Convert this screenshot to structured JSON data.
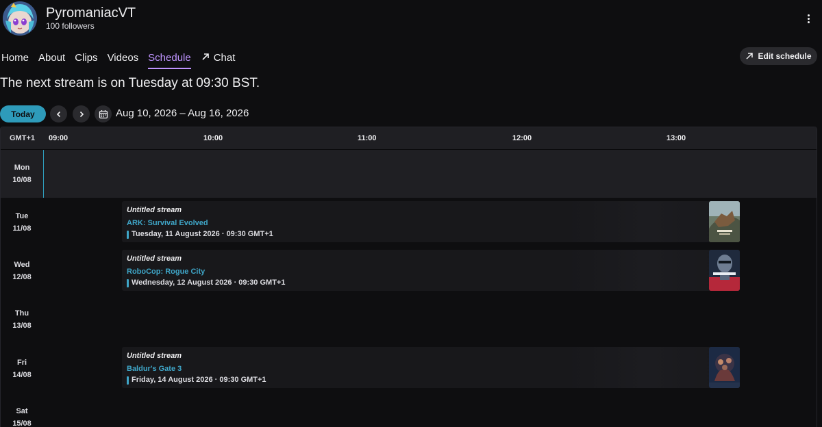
{
  "channel": {
    "name": "PyromaniacVT",
    "followers": "100 followers"
  },
  "nav": {
    "items": [
      {
        "label": "Home"
      },
      {
        "label": "About"
      },
      {
        "label": "Clips"
      },
      {
        "label": "Videos"
      },
      {
        "label": "Schedule",
        "active": true
      },
      {
        "label": "Chat",
        "icon": "external-arrow-icon"
      }
    ]
  },
  "edit_schedule_label": "Edit schedule",
  "next_stream_text": "The next stream is on Tuesday at 09:30 BST.",
  "controls": {
    "today_label": "Today",
    "date_range": "Aug 10, 2026 – Aug 16, 2026"
  },
  "grid": {
    "timezone": "GMT+1",
    "times": [
      "09:00",
      "10:00",
      "11:00",
      "12:00",
      "13:00"
    ],
    "days": [
      {
        "day": "Mon",
        "date": "10/08"
      },
      {
        "day": "Tue",
        "date": "11/08"
      },
      {
        "day": "Wed",
        "date": "12/08"
      },
      {
        "day": "Thu",
        "date": "13/08"
      },
      {
        "day": "Fri",
        "date": "14/08"
      },
      {
        "day": "Sat",
        "date": "15/08"
      }
    ],
    "events": [
      {
        "title": "Untitled stream",
        "game": "ARK: Survival Evolved",
        "time": "Tuesday, 11 August 2026 · 09:30 GMT+1"
      },
      {
        "title": "Untitled stream",
        "game": "RoboCop: Rogue City",
        "time": "Wednesday, 12 August 2026 · 09:30 GMT+1"
      },
      {
        "title": "Untitled stream",
        "game": "Baldur's Gate 3",
        "time": "Friday, 14 August 2026 · 09:30 GMT+1"
      }
    ]
  },
  "colors": {
    "background": "#0e0e10",
    "accent_purple": "#bf94ff",
    "accent_teal": "#2e9bba",
    "game_link": "#3fa6c8"
  }
}
